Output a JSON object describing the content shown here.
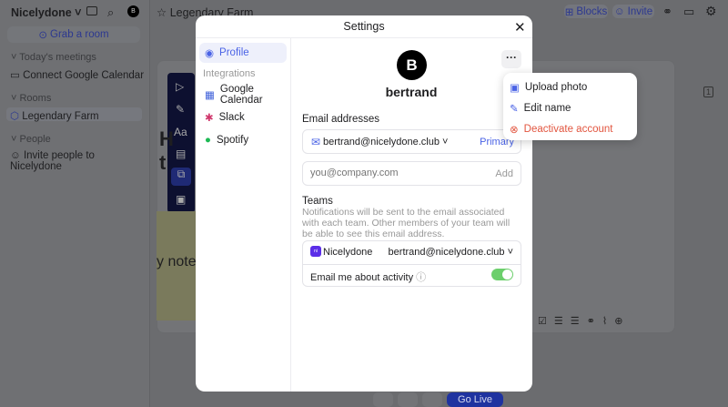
{
  "app": {
    "workspace": "Nicelydone",
    "avatar_initial": "B",
    "grab_room": "Grab a room",
    "room_title": "Legendary Farm",
    "sections": [
      {
        "label": "Today's meetings",
        "items": [
          "Connect Google Calendar"
        ]
      },
      {
        "label": "Rooms",
        "items": [
          "Legendary Farm"
        ]
      },
      {
        "label": "People",
        "items": [
          "Invite people to Nicelydone"
        ]
      }
    ],
    "header_buttons": {
      "blocks": "Blocks",
      "invite": "Invite"
    },
    "canvas_text_1": "H",
    "canvas_text_2": "t",
    "sticky_note": "y note",
    "comment_count": "1",
    "go_live": "Go Live"
  },
  "settings": {
    "title": "Settings",
    "nav": {
      "profile": "Profile",
      "integrations_label": "Integrations",
      "items": [
        "Google Calendar",
        "Slack",
        "Spotify"
      ]
    },
    "profile": {
      "avatar_initial": "B",
      "name": "bertrand"
    },
    "email_section": {
      "label": "Email addresses",
      "email": "bertrand@nicelydone.club",
      "primary": "Primary",
      "placeholder": "you@company.com",
      "add": "Add"
    },
    "teams": {
      "label": "Teams",
      "description": "Notifications will be sent to the email associated with each team. Other members of your team will be able to see this email address.",
      "team_name": "Nicelydone",
      "team_badge": "ni",
      "team_email": "bertrand@nicelydone.club",
      "activity_label": "Email me about activity",
      "activity_enabled": true
    }
  },
  "menu": {
    "items": [
      "Upload photo",
      "Edit name",
      "Deactivate account"
    ]
  },
  "colors": {
    "accent": "#4a63e6",
    "danger": "#e2553f",
    "toggle": "#6ccf6c"
  }
}
